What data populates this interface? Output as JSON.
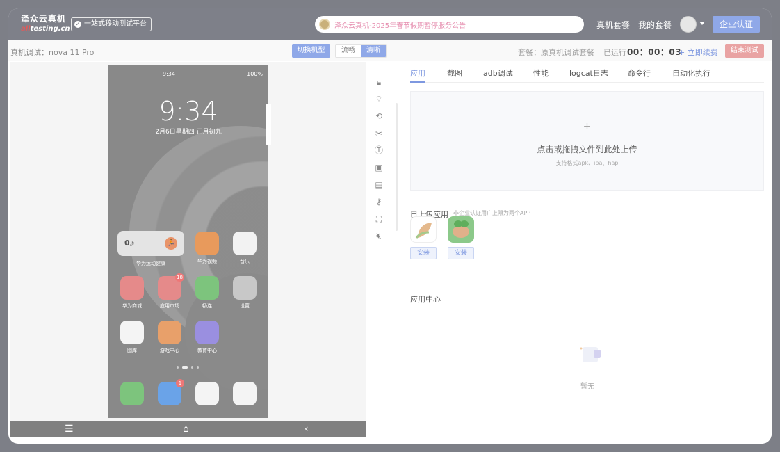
{
  "header": {
    "logo_cn": "泽众云真机",
    "logo_en_accent": "all",
    "logo_en_rest": "testing.cn",
    "slogan": "一站式移动测试平台",
    "notice": "泽众云真机-2025年春节假期暂停服务公告",
    "nav": [
      "真机套餐",
      "我的套餐"
    ],
    "cert_button": "企业认证"
  },
  "toolbar": {
    "device_label": "真机调试：nova 11 Pro",
    "switch_button": "切换机型",
    "quality_options": [
      "流畅",
      "清晰"
    ],
    "quality_selected": "清晰",
    "plan": "套餐：原真机调试套餐",
    "runtime_label": "已运行",
    "runtime_value": "00：00：03",
    "renew": "+ 立即续费",
    "end_button": "结束测试"
  },
  "phone": {
    "status_time": "9:34",
    "status_battery": "100%",
    "clock": "9:34",
    "date": "2月6日星期四  正月初九",
    "steps_value": "0",
    "steps_unit": "步",
    "apps": [
      {
        "label": "华为运动健康"
      },
      {
        "label": "华为视频"
      },
      {
        "label": "音乐"
      },
      {
        "label": "华为商城"
      },
      {
        "label": "应用市场",
        "badge": "18"
      },
      {
        "label": "畅连"
      },
      {
        "label": "设置"
      },
      {
        "label": "图库"
      },
      {
        "label": "游戏中心"
      },
      {
        "label": "教育中心"
      }
    ],
    "dock_badge": "1"
  },
  "tabs": [
    "应用",
    "截图",
    "adb调试",
    "性能",
    "logcat日志",
    "命令行",
    "自动化执行"
  ],
  "upload": {
    "plus": "+",
    "main": "点击或拖拽文件到此处上传",
    "sub": "支持格式apk、ipa、hap"
  },
  "uploaded": {
    "title": "已上传应用",
    "note": "非企业认证用户上限为两个APP",
    "install_label": "安装"
  },
  "app_center": {
    "title": "应用中心",
    "empty": "暂无"
  },
  "colors": {
    "accent": "#7e98e0",
    "danger": "#e9a3a3"
  }
}
